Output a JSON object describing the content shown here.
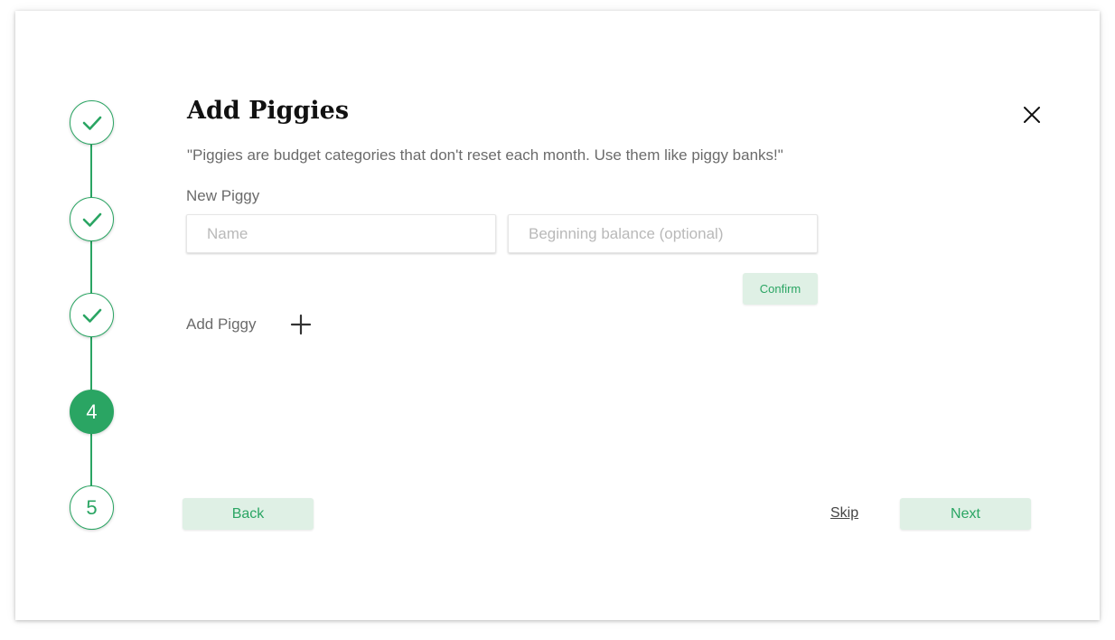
{
  "modal": {
    "title": "Add Piggies",
    "subtitle": "\"Piggies are budget categories that don't reset each month. Use them like piggy banks!\"",
    "close_icon": "close-icon"
  },
  "stepper": {
    "accent": "#2aa563",
    "current_step": 4,
    "steps": [
      {
        "status": "completed",
        "label": "",
        "icon": "check-icon"
      },
      {
        "status": "completed",
        "label": "",
        "icon": "check-icon"
      },
      {
        "status": "completed",
        "label": "",
        "icon": "check-icon"
      },
      {
        "status": "active",
        "label": "4"
      },
      {
        "status": "upcoming",
        "label": "5"
      }
    ]
  },
  "form": {
    "section_label": "New Piggy",
    "name_field": {
      "value": "",
      "placeholder": "Name"
    },
    "balance_field": {
      "value": "",
      "placeholder": "Beginning balance (optional)"
    },
    "confirm_label": "Confirm"
  },
  "add_piggy": {
    "label": "Add Piggy",
    "icon": "plus-icon"
  },
  "footer": {
    "back_label": "Back",
    "skip_label": "Skip",
    "next_label": "Next"
  },
  "colors": {
    "accent": "#2aa563",
    "button_bg": "#dff0e5",
    "text_muted": "#6b6b6b"
  }
}
